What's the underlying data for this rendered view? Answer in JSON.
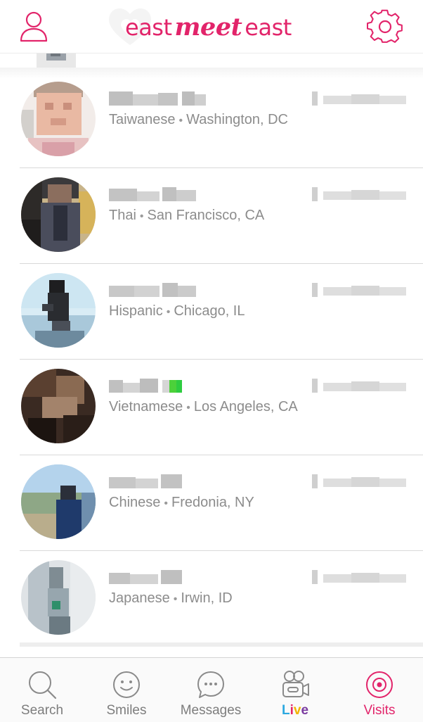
{
  "header": {
    "logo": "east meet east",
    "profile_icon": "person-outline-icon",
    "settings_icon": "gear-outline-icon",
    "accent": "#e2246a"
  },
  "visits": [
    {
      "ethnicity": "Taiwanese",
      "separator": "•",
      "location": "Washington, DC"
    },
    {
      "ethnicity": "Thai",
      "separator": "•",
      "location": "San Francisco, CA"
    },
    {
      "ethnicity": "Hispanic",
      "separator": "•",
      "location": "Chicago, IL"
    },
    {
      "ethnicity": "Vietnamese",
      "separator": "•",
      "location": "Los Angeles, CA"
    },
    {
      "ethnicity": "Chinese",
      "separator": "•",
      "location": "Fredonia, NY"
    },
    {
      "ethnicity": "Japanese",
      "separator": "•",
      "location": "Irwin, ID"
    }
  ],
  "tabs": [
    {
      "label": "Search",
      "icon": "search-icon"
    },
    {
      "label": "Smiles",
      "icon": "smiley-icon"
    },
    {
      "label": "Messages",
      "icon": "chat-bubble-icon"
    },
    {
      "label": "Live",
      "icon": "video-camera-icon"
    },
    {
      "label": "Visits",
      "icon": "visits-target-icon",
      "active": true
    }
  ]
}
